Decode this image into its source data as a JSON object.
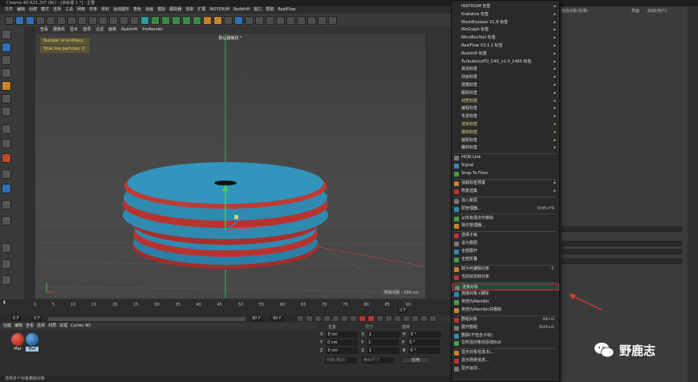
{
  "window": {
    "title": "Cinema 4D R21.207 (RC) - [未标题 1 *] - 主要"
  },
  "menubar": [
    "文件",
    "编辑",
    "创建",
    "模式",
    "选择",
    "工具",
    "网格",
    "样条",
    "体积",
    "运动图形",
    "角色",
    "动画",
    "模拟",
    "跟踪器",
    "渲染",
    "扩展",
    "INSYDIUM",
    "Redshift",
    "窗口",
    "帮助",
    "RealFlow"
  ],
  "viewport": {
    "menu": [
      "查看",
      "摄像机",
      "显示",
      "选项",
      "过滤",
      "面板",
      "Redshift",
      "ProRender"
    ],
    "title": "默认摄像机 °",
    "hud": [
      "Number of emitters: 0",
      "Total live particles: 0"
    ],
    "grid_info": "网格间距 : 100 cm",
    "colors": {
      "red": "#b8332f",
      "blue": "#2f8ab0"
    }
  },
  "timeline": {
    "ticks": [
      "0",
      "5",
      "10",
      "15",
      "20",
      "25",
      "30",
      "35",
      "40",
      "45",
      "50",
      "55",
      "60",
      "65",
      "70",
      "75",
      "80",
      "85",
      "90"
    ],
    "current": "0 F",
    "start": "0 F",
    "end": "90 F",
    "end2": "90 F",
    "frame_right": "0 F"
  },
  "materials": {
    "tabs": [
      "创建",
      "编辑",
      "查看",
      "选择",
      "材质",
      "纹理",
      "Cycles 4D"
    ],
    "items": [
      {
        "label": "Mat",
        "color": "#c0392b"
      },
      {
        "label": "Mat",
        "color": "#2b6fa8"
      }
    ]
  },
  "coords": {
    "headers": [
      "位置",
      "尺寸",
      "旋转"
    ],
    "rows": [
      {
        "axis": "X",
        "pos": "0 cm",
        "size": "1",
        "rot_axis": "H",
        "rot": "0 °"
      },
      {
        "axis": "Y",
        "pos": "0 cm",
        "size": "1",
        "rot_axis": "P",
        "rot": "0 °"
      },
      {
        "axis": "Z",
        "pos": "0 cm",
        "size": "1",
        "rot_axis": "B",
        "rot": "0 °"
      }
    ],
    "mode": "对象(相对)",
    "size_mode": "绝对尺寸",
    "apply": "应用"
  },
  "status": "选择多个对象删除对象",
  "right_panel": {
    "header_mode": "当前对象(标准)",
    "layout": "界面",
    "startup": "启动(用户)"
  },
  "context_menu": {
    "items": [
      {
        "label": "INSYDIUM 标签",
        "arrow": true,
        "style": "normal"
      },
      {
        "label": "Krakatoa 标签",
        "arrow": true,
        "style": "normal"
      },
      {
        "label": "MeshBoolean V1.8 标签",
        "arrow": true,
        "style": "normal"
      },
      {
        "label": "MoGraph 标签",
        "arrow": true,
        "style": "normal"
      },
      {
        "label": "NitroBoxTool 标签",
        "arrow": true,
        "style": "normal"
      },
      {
        "label": "RealFlow V3.1.1 标签",
        "arrow": true,
        "style": "normal"
      },
      {
        "label": "Redshift 标签",
        "arrow": true,
        "style": "normal"
      },
      {
        "label": "TurbulenceFD_C4D_v1-0_1465 标签",
        "arrow": true,
        "style": "normal"
      },
      {
        "label": "其他标签",
        "arrow": true,
        "style": "normal"
      },
      {
        "label": "动画标签",
        "arrow": true,
        "style": "normal"
      },
      {
        "label": "建模标签",
        "arrow": true,
        "style": "normal"
      },
      {
        "label": "跟踪标签",
        "arrow": true,
        "style": "normal"
      },
      {
        "label": "材质标签",
        "arrow": true,
        "style": "yellow"
      },
      {
        "label": "编程标签",
        "arrow": true,
        "style": "normal"
      },
      {
        "label": "毛发标签",
        "arrow": true,
        "style": "normal"
      },
      {
        "label": "渲染标签",
        "arrow": true,
        "style": "yellow"
      },
      {
        "label": "模拟标签",
        "arrow": true,
        "style": "yellow"
      },
      {
        "label": "装配标签",
        "arrow": true,
        "style": "normal"
      },
      {
        "label": "雕刻标签",
        "arrow": true,
        "style": "normal"
      },
      {
        "label": "HDRI Link",
        "arrow": false,
        "style": "normal"
      },
      {
        "label": "Signal",
        "arrow": false,
        "style": "normal"
      },
      {
        "label": "Snap To Floor",
        "arrow": false,
        "style": "normal"
      },
      {
        "label": "加载标签预置",
        "arrow": true,
        "style": "normal"
      },
      {
        "label": "恢复选集",
        "arrow": true,
        "style": "normal"
      },
      {
        "label": "加入新层",
        "arrow": false,
        "style": "normal"
      },
      {
        "label": "层管理器...",
        "arrow": false,
        "shortcut": "Shift+F4",
        "style": "normal"
      },
      {
        "label": "从所有场次中移除",
        "arrow": false,
        "style": "normal"
      },
      {
        "label": "场次管理器...",
        "arrow": false,
        "style": "normal"
      },
      {
        "label": "选择子级",
        "arrow": false,
        "style": "normal"
      },
      {
        "label": "设为根层",
        "arrow": false,
        "style": "normal"
      },
      {
        "label": "全部展开",
        "arrow": false,
        "style": "normal"
      },
      {
        "label": "全部折叠",
        "arrow": false,
        "style": "normal"
      },
      {
        "label": "转为可编辑对象",
        "arrow": false,
        "shortcut": "C",
        "style": "normal"
      },
      {
        "label": "当前状态转对象",
        "arrow": false,
        "style": "normal"
      },
      {
        "label": "连接对象",
        "arrow": false,
        "style": "highlight"
      },
      {
        "label": "连接对象+删除",
        "arrow": false,
        "style": "normal"
      },
      {
        "label": "烘焙为Alembic",
        "arrow": false,
        "style": "normal"
      },
      {
        "label": "烘焙为Alembic并删除",
        "arrow": false,
        "style": "normal"
      },
      {
        "label": "群组对象",
        "arrow": false,
        "shortcut": "Alt+G",
        "style": "normal"
      },
      {
        "label": "展开群组",
        "arrow": false,
        "shortcut": "Shift+G",
        "style": "normal"
      },
      {
        "label": "删除(不包含子级)",
        "arrow": false,
        "style": "normal"
      },
      {
        "label": "在所选对象前添加Null",
        "arrow": false,
        "style": "normal"
      },
      {
        "label": "显示对象信息(Ⅱ)...",
        "arrow": false,
        "style": "normal"
      },
      {
        "label": "显示场景信息...",
        "arrow": false,
        "style": "normal"
      },
      {
        "label": "显示运动...",
        "arrow": false,
        "style": "normal"
      }
    ]
  },
  "watermark": {
    "text": "野鹿志"
  }
}
